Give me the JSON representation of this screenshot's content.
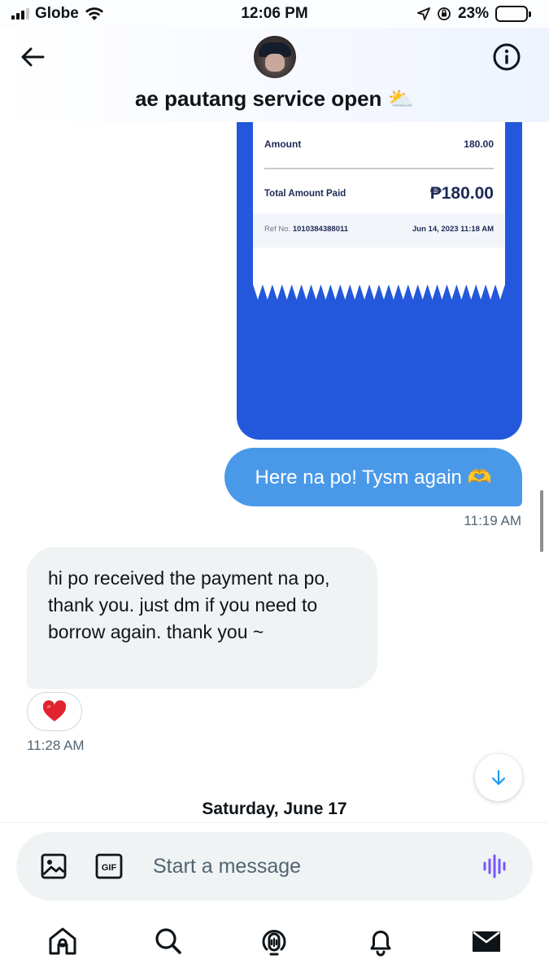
{
  "status_bar": {
    "carrier": "Globe",
    "time": "12:06 PM",
    "battery": "23%",
    "battery_level": 0.23
  },
  "header": {
    "title": "ae pautang service open ⛅"
  },
  "receipt": {
    "amount_label": "Amount",
    "amount_value": "180.00",
    "total_label": "Total Amount Paid",
    "total_value": "₱180.00",
    "ref_label": "Ref No.",
    "ref_value": "1010384388011",
    "date": "Jun 14, 2023 11:18 AM",
    "accent_color": "#2458dc"
  },
  "messages": {
    "outgoing_text": "Here na po! Tysm again 🫶",
    "outgoing_time": "11:19 AM",
    "incoming_text": "hi po received the payment na po, thank you. just dm if you need to borrow again. thank you ~",
    "incoming_reaction": "❤️",
    "incoming_time": "11:28 AM",
    "date_separator": "Saturday, June 17"
  },
  "composer": {
    "placeholder": "Start a message",
    "media_icon": "image-icon",
    "gif_icon": "gif-icon",
    "voice_icon": "voice-message-icon"
  },
  "nav": {
    "items": [
      "home-icon",
      "search-icon",
      "spaces-icon",
      "notifications-icon",
      "messages-icon"
    ]
  },
  "colors": {
    "outgoing_bubble": "#4a99e9",
    "incoming_bubble": "#eff3f4",
    "voice_accent": "#7856ff",
    "link_blue": "#1d9bf0"
  }
}
